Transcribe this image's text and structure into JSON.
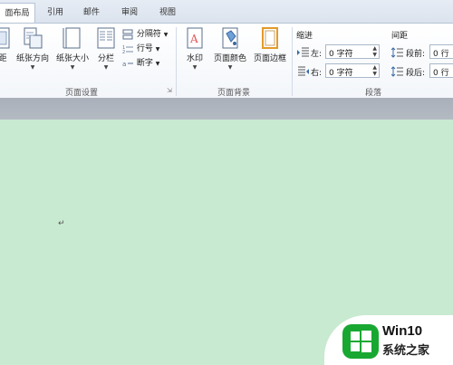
{
  "tabs": [
    {
      "label": "面布局",
      "active": true
    },
    {
      "label": "引用",
      "active": false
    },
    {
      "label": "邮件",
      "active": false
    },
    {
      "label": "审阅",
      "active": false
    },
    {
      "label": "视图",
      "active": false
    }
  ],
  "page_setup": {
    "margins_label": "距",
    "orientation_label": "纸张方向",
    "size_label": "纸张大小",
    "columns_label": "分栏",
    "breaks_label": "分隔符",
    "line_numbers_label": "行号",
    "hyphenation_label": "断字",
    "group_label": "页面设置"
  },
  "page_background": {
    "watermark_label": "水印",
    "page_color_label": "页面颜色",
    "page_borders_label": "页面边框",
    "group_label": "页面背景"
  },
  "paragraph": {
    "indent_header": "缩进",
    "spacing_header": "间距",
    "left_label": "左:",
    "left_value": "0 字符",
    "right_label": "右:",
    "right_value": "0 字符",
    "before_label": "段前:",
    "before_value": "0 行",
    "after_label": "段后:",
    "after_value": "0 行",
    "group_label": "段落"
  },
  "document": {
    "paragraph_mark": "↵",
    "background_color": "#c8ead0"
  },
  "watermark_logo": {
    "title": "Win10",
    "subtitle": "系统之家",
    "logo_color": "#18a832"
  }
}
